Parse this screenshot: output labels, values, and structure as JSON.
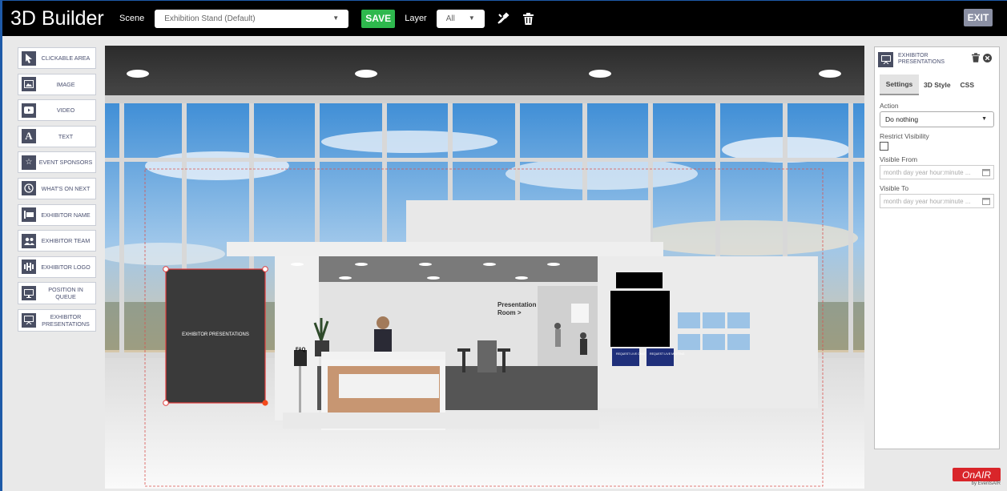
{
  "header": {
    "app_title": "3D Builder",
    "scene_label": "Scene",
    "scene_value": "Exhibition Stand (Default)",
    "save_label": "SAVE",
    "layer_label": "Layer",
    "layer_value": "All",
    "exit_label": "EXIT"
  },
  "sidebar": {
    "items": [
      {
        "label": "CLICKABLE AREA",
        "icon": "cursor-icon"
      },
      {
        "label": "IMAGE",
        "icon": "image-icon"
      },
      {
        "label": "VIDEO",
        "icon": "video-icon"
      },
      {
        "label": "TEXT",
        "icon": "text-icon"
      },
      {
        "label": "EVENT SPONSORS",
        "icon": "sponsors-icon"
      },
      {
        "label": "WHAT'S ON NEXT",
        "icon": "clock-icon"
      },
      {
        "label": "EXHIBITOR NAME",
        "icon": "name-icon"
      },
      {
        "label": "EXHIBITOR TEAM",
        "icon": "team-icon"
      },
      {
        "label": "EXHIBITOR LOGO",
        "icon": "logo-icon"
      },
      {
        "label": "POSITION IN QUEUE",
        "icon": "monitor-icon"
      },
      {
        "label": "EXHIBITOR PRESENTATIONS",
        "icon": "presentation-icon"
      }
    ]
  },
  "canvas": {
    "selected_label": "EXHIBITOR PRESENTATIONS",
    "faq_label": "FAQ",
    "room_label": "Presentation\nRoom >",
    "tablet_left": "REQUEST LIVE CHAT",
    "tablet_right": "REQUEST LIVE MEETING"
  },
  "panel": {
    "title": "EXHIBITOR PRESENTATIONS",
    "tabs": [
      "Settings",
      "3D Style",
      "CSS"
    ],
    "action_label": "Action",
    "action_value": "Do nothing",
    "restrict_label": "Restrict Visibility",
    "visible_from_label": "Visible From",
    "visible_from_placeholder": "month day year hour:minute ...",
    "visible_to_label": "Visible To",
    "visible_to_placeholder": "month day year hour:minute ..."
  },
  "brand": {
    "logo": "OnAIR",
    "sub": "by EventsAIR"
  },
  "colors": {
    "save_green": "#2eb84d",
    "exit_gray": "#8a8fa3",
    "selection_red": "#e23b3b",
    "brand_red": "#d9252a"
  }
}
